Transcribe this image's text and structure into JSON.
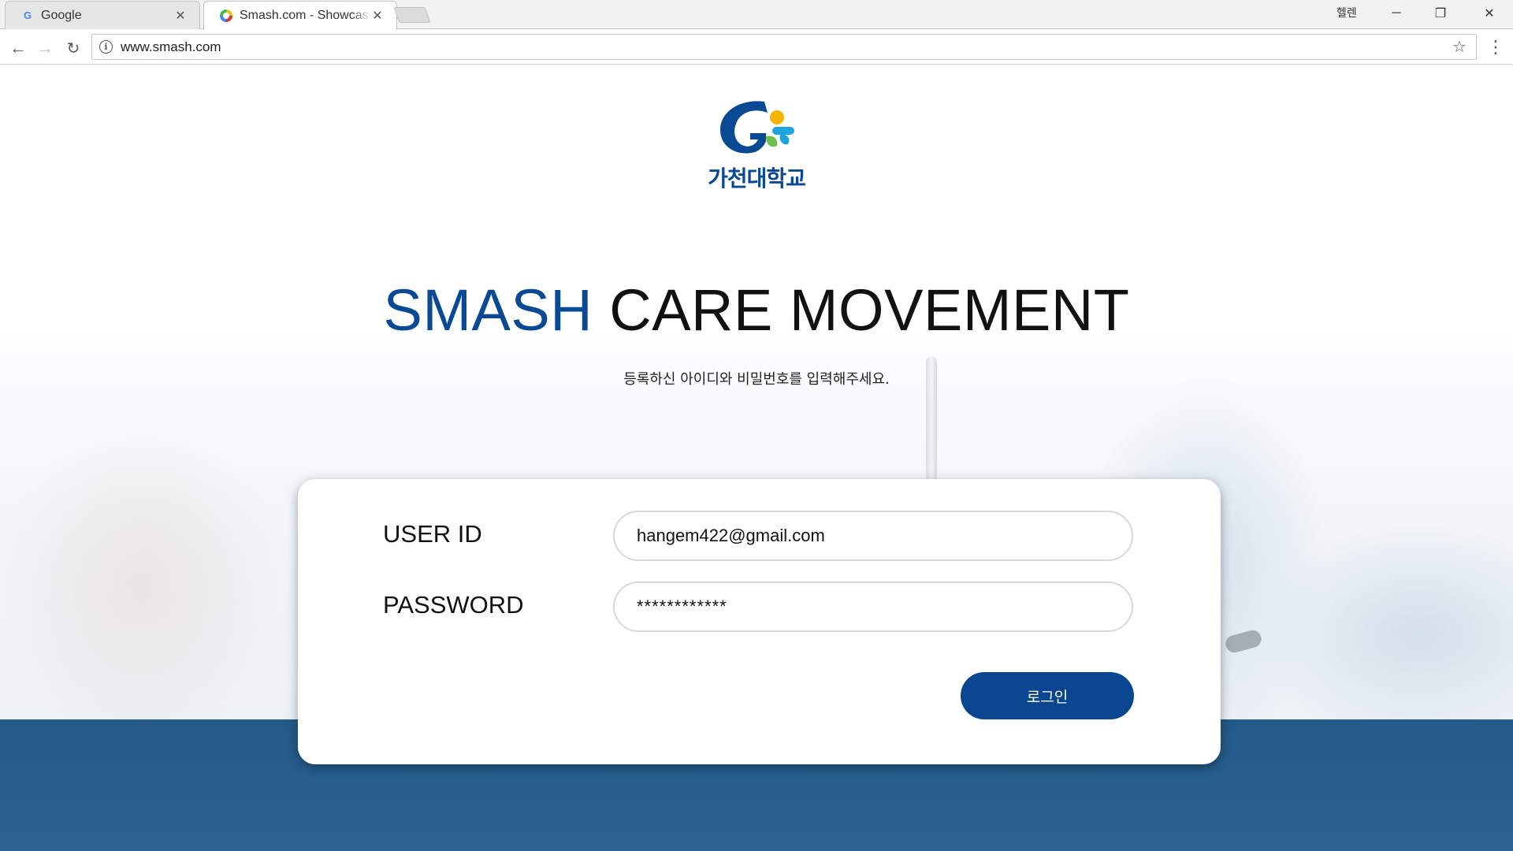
{
  "browser": {
    "tabs": [
      {
        "title": "Google",
        "favicon": "google-g-icon",
        "active": false
      },
      {
        "title": "Smash.com - Showcasin",
        "favicon": "smash-favicon",
        "active": true
      }
    ],
    "profile_label": "헬렌",
    "url": "www.smash.com"
  },
  "page": {
    "logo_text": "가천대학교",
    "headline_accent": "SMASH",
    "headline_rest": " CARE MOVEMENT",
    "subtext": "등록하신 아이디와 비밀번호를 입력해주세요.",
    "form": {
      "user_id_label": "USER ID",
      "user_id_value": "hangem422@gmail.com",
      "password_label": "PASSWORD",
      "password_value": "************",
      "login_button": "로그인"
    }
  },
  "colors": {
    "brand_blue": "#0a4a94",
    "button_blue": "#0a4590",
    "band_blue": "#245a8a"
  }
}
